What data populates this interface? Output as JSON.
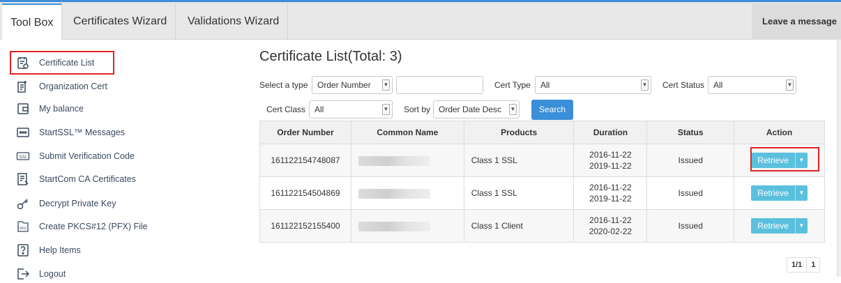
{
  "tabs": [
    {
      "label": "Tool Box",
      "active": true
    },
    {
      "label": "Certificates Wizard",
      "active": false
    },
    {
      "label": "Validations Wizard",
      "active": false
    }
  ],
  "leave_message": "Leave a message",
  "sidebar": {
    "items": [
      {
        "label": "Certificate List",
        "icon": "certificate-list-icon"
      },
      {
        "label": "Organization Cert",
        "icon": "organization-cert-icon"
      },
      {
        "label": "My balance",
        "icon": "wallet-icon"
      },
      {
        "label": "StartSSL™ Messages",
        "icon": "message-icon"
      },
      {
        "label": "Submit Verification Code",
        "icon": "ssl-code-icon"
      },
      {
        "label": "StartCom CA Certificates",
        "icon": "ca-certificate-icon"
      },
      {
        "label": "Decrypt Private Key",
        "icon": "key-icon"
      },
      {
        "label": "Create PKCS#12 (PFX) File",
        "icon": "pfx-file-icon"
      },
      {
        "label": "Help Items",
        "icon": "help-icon"
      },
      {
        "label": "Logout",
        "icon": "logout-icon"
      }
    ]
  },
  "main": {
    "title": "Certificate List(Total: 3)",
    "filters": {
      "select_type_label": "Select a type",
      "select_type_value": "Order Number",
      "search_text_value": "",
      "cert_type_label": "Cert Type",
      "cert_type_value": "All",
      "cert_status_label": "Cert Status",
      "cert_status_value": "All",
      "cert_class_label": "Cert Class",
      "cert_class_value": "All",
      "sort_by_label": "Sort by",
      "sort_by_value": "Order Date Desc",
      "search_button": "Search"
    },
    "table": {
      "columns": [
        "Order Number",
        "Common Name",
        "Products",
        "Duration",
        "Status",
        "Action"
      ],
      "rows": [
        {
          "order": "161122154748087",
          "common_name": "",
          "product": "Class 1 SSL",
          "start": "2016-11-22",
          "end": "2019-11-22",
          "status": "Issued",
          "action": "Retrieve"
        },
        {
          "order": "161122154504869",
          "common_name": "",
          "product": "Class 1 SSL",
          "start": "2016-11-22",
          "end": "2019-11-22",
          "status": "Issued",
          "action": "Retrieve"
        },
        {
          "order": "161122152155400",
          "common_name": "",
          "product": "Class 1 Client",
          "start": "2016-11-22",
          "end": "2020-02-22",
          "status": "Issued",
          "action": "Retrieve"
        }
      ]
    },
    "pager": {
      "summary": "1/1",
      "current": "1"
    }
  },
  "colors": {
    "accent": "#3b8ed8",
    "retrieve": "#5bc0de",
    "highlight": "#e02222"
  }
}
